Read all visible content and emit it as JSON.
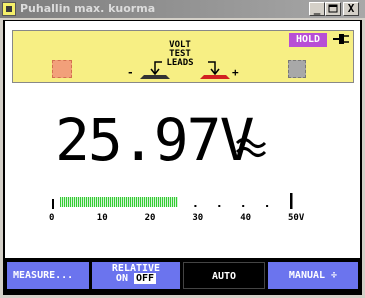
{
  "window": {
    "title": "Puhallin max. kuorma",
    "minimize": "_",
    "maximize": "□",
    "close": "X"
  },
  "probe": {
    "hold": "HOLD",
    "volt": "VOLT",
    "test": "TEST",
    "leads": "LEADS",
    "minus": "-",
    "plus": "+"
  },
  "reading": {
    "value": "25.97",
    "unit": "V"
  },
  "bar_graph": {
    "value": 25.97,
    "max": 50,
    "scale_labels": [
      "0",
      "10",
      "20",
      "30",
      "40",
      "50V"
    ],
    "fill_color": "#33cc33"
  },
  "softkeys": {
    "measure": "MEASURE...",
    "relative_line1": "RELATIVE",
    "relative_on": "ON",
    "relative_off": "OFF",
    "auto": "AUTO",
    "manual": "MANUAL ÷"
  },
  "colors": {
    "banner": "#f7ef84",
    "hold": "#b84ed6",
    "softkey": "#6b74ee"
  }
}
